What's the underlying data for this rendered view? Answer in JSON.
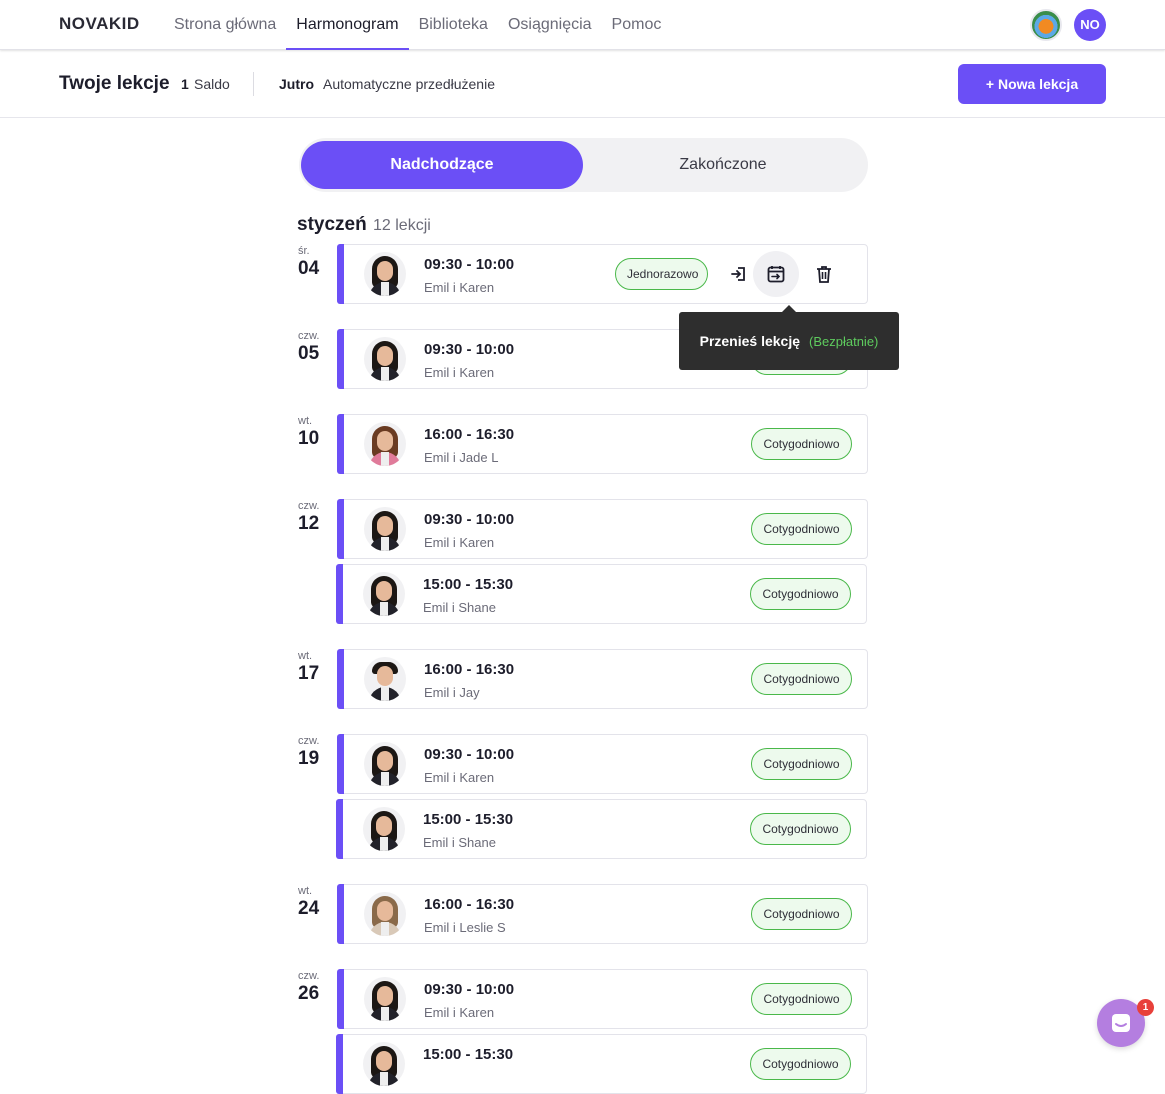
{
  "app": {
    "logo_text": "NOVAKID",
    "nav": [
      "Strona główna",
      "Harmonogram",
      "Biblioteka",
      "Osiągnięcia",
      "Pomoc"
    ],
    "active_nav_index": 1,
    "user_initials": "NO"
  },
  "subbar": {
    "title": "Twoje lekcje",
    "balance_value": "1",
    "balance_label": "Saldo",
    "tomorrow_label": "Jutro",
    "renewal_label": "Automatyczne przedłużenie",
    "new_lesson_button": "+ Nowa lekcja"
  },
  "tabs": {
    "upcoming": "Nadchodzące",
    "completed": "Zakończone",
    "active": "upcoming"
  },
  "month": {
    "name": "styczeń",
    "count_label": "12 lekcji"
  },
  "days": [
    {
      "dow": "śr.",
      "day": "04",
      "lessons": [
        {
          "time": "09:30 - 10:00",
          "names": "Emil i Karen",
          "badge": "Jednorazowo",
          "teacher": "karen",
          "actions": [
            "enter-icon",
            "reschedule-icon",
            "trash-icon"
          ]
        }
      ]
    },
    {
      "dow": "czw.",
      "day": "05",
      "lessons": [
        {
          "time": "09:30 - 10:00",
          "names": "Emil i Karen",
          "badge": "Cotygodniowo",
          "teacher": "karen"
        }
      ]
    },
    {
      "dow": "wt.",
      "day": "10",
      "lessons": [
        {
          "time": "16:00 - 16:30",
          "names": "Emil i Jade L",
          "badge": "Cotygodniowo",
          "teacher": "jade"
        }
      ]
    },
    {
      "dow": "czw.",
      "day": "12",
      "lessons": [
        {
          "time": "09:30 - 10:00",
          "names": "Emil i Karen",
          "badge": "Cotygodniowo",
          "teacher": "karen"
        },
        {
          "time": "15:00 - 15:30",
          "names": "Emil i Shane",
          "badge": "Cotygodniowo",
          "teacher": "shane"
        }
      ]
    },
    {
      "dow": "wt.",
      "day": "17",
      "lessons": [
        {
          "time": "16:00 - 16:30",
          "names": "Emil i Jay",
          "badge": "Cotygodniowo",
          "teacher": "jay"
        }
      ]
    },
    {
      "dow": "czw.",
      "day": "19",
      "lessons": [
        {
          "time": "09:30 - 10:00",
          "names": "Emil i Karen",
          "badge": "Cotygodniowo",
          "teacher": "karen"
        },
        {
          "time": "15:00 - 15:30",
          "names": "Emil i Shane",
          "badge": "Cotygodniowo",
          "teacher": "shane"
        }
      ]
    },
    {
      "dow": "wt.",
      "day": "24",
      "lessons": [
        {
          "time": "16:00 - 16:30",
          "names": "Emil i Leslie S",
          "badge": "Cotygodniowo",
          "teacher": "leslie"
        }
      ]
    },
    {
      "dow": "czw.",
      "day": "26",
      "lessons": [
        {
          "time": "09:30 - 10:00",
          "names": "Emil i Karen",
          "badge": "Cotygodniowo",
          "teacher": "karen"
        },
        {
          "time": "15:00 - 15:30",
          "names": "",
          "badge": "Cotygodniowo",
          "teacher": "shane"
        }
      ]
    }
  ],
  "tooltip": {
    "text": "Przenieś lekcję",
    "free_label": "(Bezpłatnie)"
  },
  "chat": {
    "unread_count": "1"
  },
  "colors": {
    "accent": "#6b4ff6",
    "badge_border": "#4ab84a",
    "badge_bg": "#edfaed",
    "tooltip_bg": "#2e2e2e",
    "free_green": "#5ecb5e",
    "chat_bubble": "#b47ee0",
    "notification_red": "#e8403a"
  }
}
